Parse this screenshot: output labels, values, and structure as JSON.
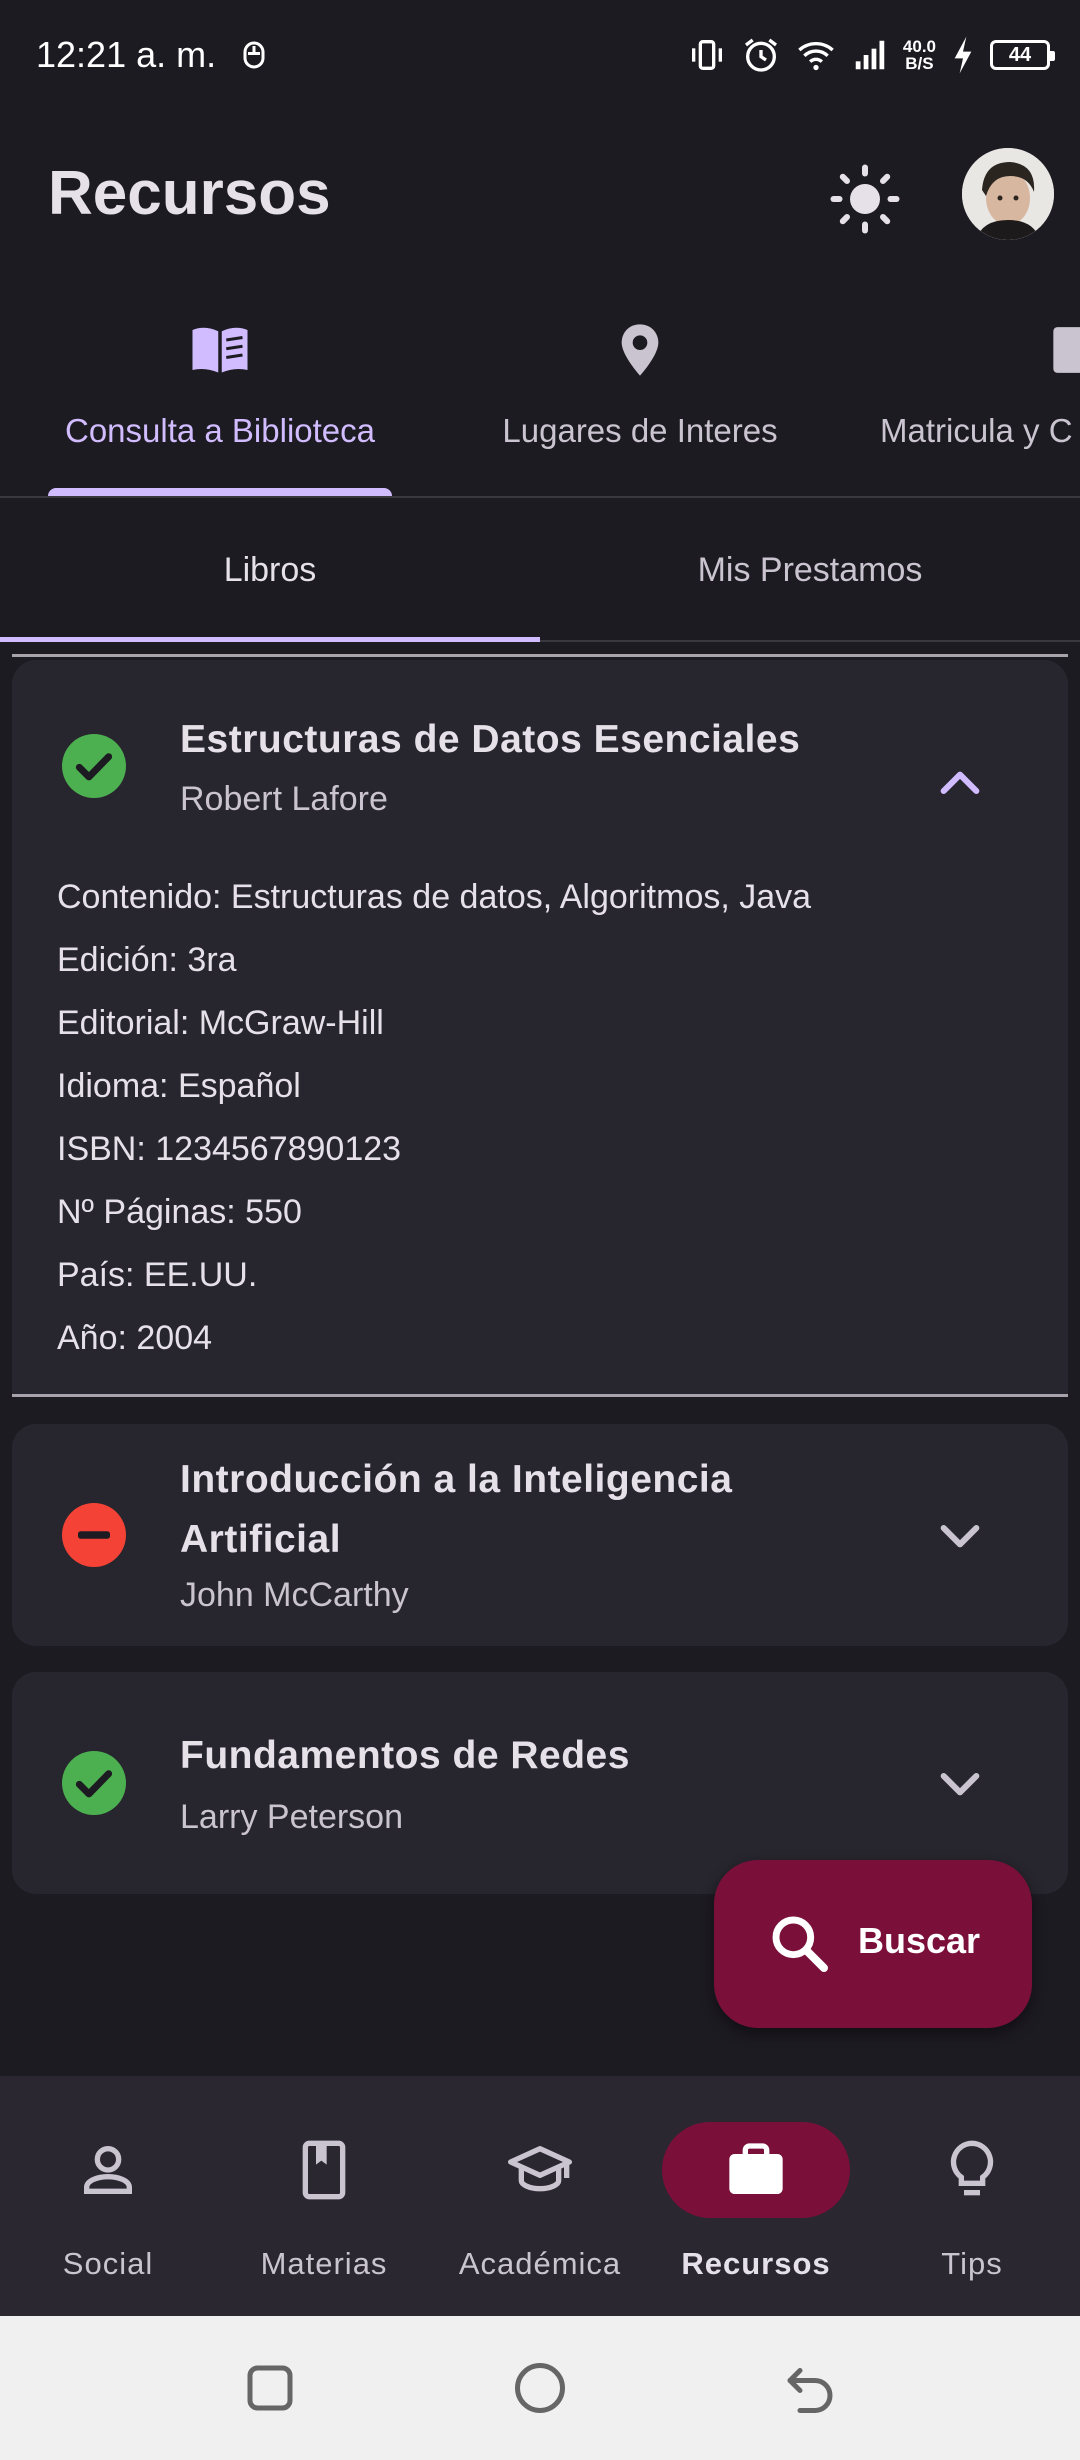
{
  "status_bar": {
    "time": "12:21 a. m.",
    "net_speed_value": "40.0",
    "net_speed_unit": "B/S",
    "battery": "44"
  },
  "app_bar": {
    "title": "Recursos"
  },
  "primary_tabs": [
    {
      "label": "Consulta a Biblioteca",
      "icon": "book-open-icon",
      "active": true
    },
    {
      "label": "Lugares de Interes",
      "icon": "location-pin-icon",
      "active": false
    },
    {
      "label": "Matricula y C",
      "icon": "document-icon",
      "active": false
    }
  ],
  "secondary_tabs": [
    {
      "label": "Libros",
      "active": true
    },
    {
      "label": "Mis Prestamos",
      "active": false
    }
  ],
  "books": [
    {
      "title": "Estructuras de Datos Esenciales",
      "author": "Robert Lafore",
      "available": true,
      "expanded": true,
      "details": [
        "Contenido: Estructuras de datos, Algoritmos, Java",
        "Edición: 3ra",
        "Editorial: McGraw-Hill",
        "Idioma: Español",
        "ISBN: 1234567890123",
        "Nº Páginas: 550",
        "País: EE.UU.",
        "Año: 2004"
      ]
    },
    {
      "title_line1": "Introducción a la Inteligencia",
      "title_line2": "Artificial",
      "author": "John McCarthy",
      "available": false,
      "expanded": false
    },
    {
      "title": "Fundamentos de Redes",
      "author": "Larry Peterson",
      "available": true,
      "expanded": false
    }
  ],
  "fab": {
    "label": "Buscar",
    "icon": "search-icon"
  },
  "bottom_nav": [
    {
      "label": "Social",
      "icon": "person-icon",
      "active": false
    },
    {
      "label": "Materias",
      "icon": "book-icon",
      "active": false
    },
    {
      "label": "Académica",
      "icon": "graduation-cap-icon",
      "active": false
    },
    {
      "label": "Recursos",
      "icon": "briefcase-icon",
      "active": true
    },
    {
      "label": "Tips",
      "icon": "lightbulb-icon",
      "active": false
    }
  ],
  "colors": {
    "background": "#1d1b22",
    "card": "#27252d",
    "accent": "#d0bcff",
    "fab": "#7a0f3a",
    "available": "#4caf50",
    "unavailable": "#f44336"
  }
}
